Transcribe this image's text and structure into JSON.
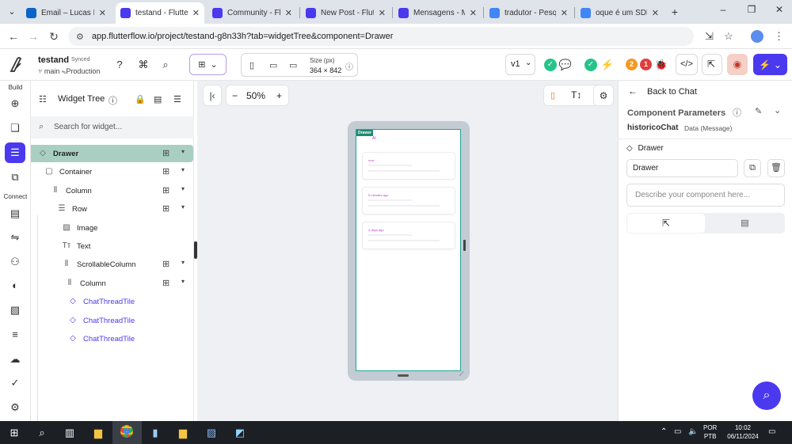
{
  "browser": {
    "tabs": [
      {
        "label": "Email – Lucas Pe",
        "favicon_color": "#0a64c9"
      },
      {
        "label": "testand - Flutterfl",
        "favicon_color": "#4b39ef",
        "active": true
      },
      {
        "label": "Community - Flu",
        "favicon_color": "#4b39ef"
      },
      {
        "label": "New Post - Flutt",
        "favicon_color": "#4b39ef"
      },
      {
        "label": "Mensagens - Me",
        "favicon_color": "#4b39ef"
      },
      {
        "label": "tradutor - Pesqu",
        "favicon_color": "#4285f4"
      },
      {
        "label": "oque é um SDK",
        "favicon_color": "#4285f4"
      }
    ],
    "new_tab": "+",
    "url": "app.flutterflow.io/project/testand-g8n33h?tab=widgetTree&component=Drawer"
  },
  "topbar": {
    "project_name": "testand",
    "sync_status": "Synced",
    "branch": "main",
    "environment": "Production",
    "size_label": "Size (px)",
    "size_value": "364 × 842",
    "version": "v1",
    "badge_orange": "2",
    "badge_red": "1"
  },
  "rail": {
    "build_label": "Build",
    "connect_label": "Connect"
  },
  "widget_tree": {
    "title": "Widget Tree",
    "search_placeholder": "Search for widget...",
    "items": [
      {
        "label": "Drawer",
        "icon": "gem-icon",
        "selected": true
      },
      {
        "label": "Container",
        "icon": "square-icon"
      },
      {
        "label": "Column",
        "icon": "column-icon"
      },
      {
        "label": "Row",
        "icon": "row-icon"
      },
      {
        "label": "Image",
        "icon": "image-icon"
      },
      {
        "label": "Text",
        "icon": "text-icon"
      },
      {
        "label": "ScrollableColumn",
        "icon": "column-icon"
      },
      {
        "label": "Column",
        "icon": "column-icon"
      },
      {
        "label": "ChatThreadTile",
        "icon": "gem-icon",
        "component": true
      },
      {
        "label": "ChatThreadTile",
        "icon": "gem-icon",
        "component": true
      },
      {
        "label": "ChatThreadTile",
        "icon": "gem-icon",
        "component": true
      }
    ]
  },
  "canvas": {
    "zoom": "50%",
    "drawer_tag": "Drawer",
    "screen_title_ai": "AI",
    "cards": [
      {
        "time": "now"
      },
      {
        "time": "5 minutes ago"
      },
      {
        "time": "3 days ago"
      }
    ]
  },
  "right_panel": {
    "back_label": "Back to Chat",
    "section_title": "Component Parameters",
    "param_name": "historicoChat",
    "param_type": "Data (Message)",
    "component_label": "Drawer",
    "component_name_value": "Drawer",
    "description_placeholder": "Describe your component here..."
  },
  "taskbar": {
    "lang_line1": "POR",
    "lang_line2": "PTB",
    "time": "10:02",
    "date": "06/11/2024"
  }
}
